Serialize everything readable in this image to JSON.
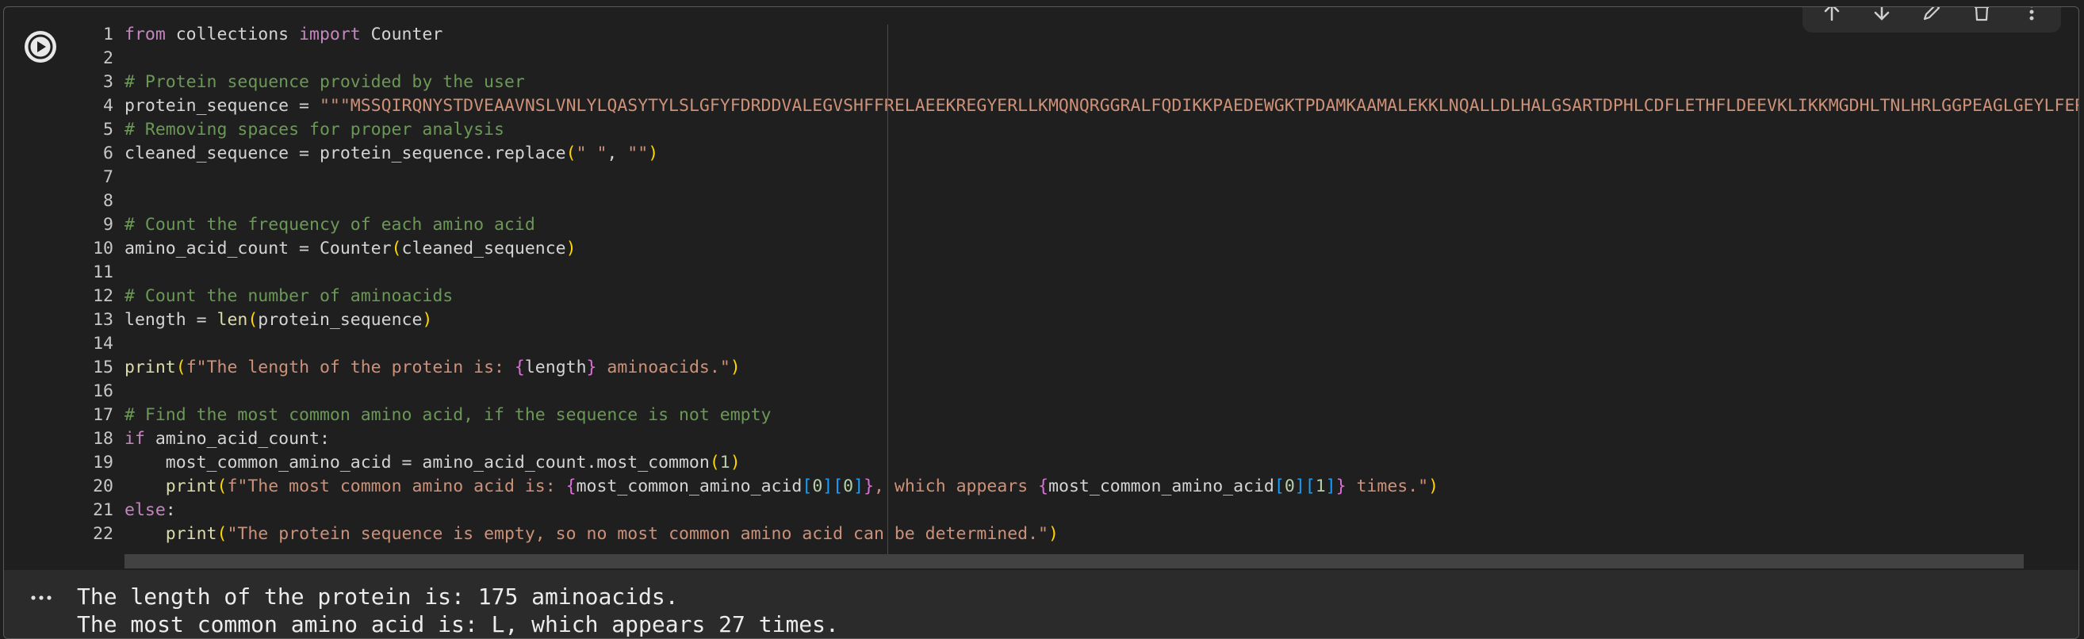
{
  "toolbar": {
    "icons": [
      "move-up-icon",
      "move-down-icon",
      "edit-icon",
      "delete-icon",
      "more-options-icon"
    ]
  },
  "run_button": {
    "icon": "play-icon"
  },
  "code_lines": [
    {
      "n": "1",
      "segments": [
        {
          "t": "from",
          "c": "kw"
        },
        {
          "t": " collections ",
          "c": ""
        },
        {
          "t": "import",
          "c": "kw"
        },
        {
          "t": " Counter",
          "c": ""
        }
      ]
    },
    {
      "n": "2",
      "segments": []
    },
    {
      "n": "3",
      "segments": [
        {
          "t": "# Protein sequence provided by the user",
          "c": "com"
        }
      ]
    },
    {
      "n": "4",
      "segments": [
        {
          "t": "protein_sequence = ",
          "c": ""
        },
        {
          "t": "\"\"\"MSSQIRQNYSTDVEAAVNSLVNLYLQASYTYLSLGFYFDRDDVALEGVSHFFRELAEEKREGYERLLKMQNQRGGRALFQDIKKPAEDEWGKTPDAMKAAMALEKKLNQALLDLHALGSARTDPHLCDFLETHFLDEEVKLIKKMGDHLTNLHRLGGPEAGLGEYLFERLTLKHD\"\"\"",
          "c": "str"
        }
      ]
    },
    {
      "n": "5",
      "segments": [
        {
          "t": "# Removing spaces for proper analysis",
          "c": "com"
        }
      ]
    },
    {
      "n": "6",
      "segments": [
        {
          "t": "cleaned_sequence = protein_sequence.replace",
          "c": ""
        },
        {
          "t": "(",
          "c": "par"
        },
        {
          "t": "\" \"",
          "c": "str"
        },
        {
          "t": ", ",
          "c": ""
        },
        {
          "t": "\"\"",
          "c": "str"
        },
        {
          "t": ")",
          "c": "par"
        }
      ]
    },
    {
      "n": "7",
      "segments": []
    },
    {
      "n": "8",
      "segments": []
    },
    {
      "n": "9",
      "segments": [
        {
          "t": "# Count the frequency of each amino acid",
          "c": "com"
        }
      ]
    },
    {
      "n": "10",
      "segments": [
        {
          "t": "amino_acid_count = Counter",
          "c": ""
        },
        {
          "t": "(",
          "c": "par"
        },
        {
          "t": "cleaned_sequence",
          "c": ""
        },
        {
          "t": ")",
          "c": "par"
        }
      ]
    },
    {
      "n": "11",
      "segments": []
    },
    {
      "n": "12",
      "segments": [
        {
          "t": "# Count the number of aminoacids",
          "c": "com"
        }
      ]
    },
    {
      "n": "13",
      "segments": [
        {
          "t": "length = ",
          "c": ""
        },
        {
          "t": "len",
          "c": "fn"
        },
        {
          "t": "(",
          "c": "par"
        },
        {
          "t": "protein_sequence",
          "c": ""
        },
        {
          "t": ")",
          "c": "par"
        }
      ]
    },
    {
      "n": "14",
      "segments": []
    },
    {
      "n": "15",
      "segments": [
        {
          "t": "print",
          "c": "fn"
        },
        {
          "t": "(",
          "c": "par"
        },
        {
          "t": "f\"The length of the protein is: ",
          "c": "str"
        },
        {
          "t": "{",
          "c": "br2"
        },
        {
          "t": "length",
          "c": ""
        },
        {
          "t": "}",
          "c": "br2"
        },
        {
          "t": " aminoacids.\"",
          "c": "str"
        },
        {
          "t": ")",
          "c": "par"
        }
      ]
    },
    {
      "n": "16",
      "segments": []
    },
    {
      "n": "17",
      "segments": [
        {
          "t": "# Find the most common amino acid, if the sequence is not empty",
          "c": "com"
        }
      ]
    },
    {
      "n": "18",
      "segments": [
        {
          "t": "if",
          "c": "kw"
        },
        {
          "t": " amino_acid_count:",
          "c": ""
        }
      ]
    },
    {
      "n": "19",
      "segments": [
        {
          "t": "    most_common_amino_acid = amino_acid_count.most_common",
          "c": ""
        },
        {
          "t": "(",
          "c": "par"
        },
        {
          "t": "1",
          "c": "num"
        },
        {
          "t": ")",
          "c": "par"
        }
      ]
    },
    {
      "n": "20",
      "segments": [
        {
          "t": "    ",
          "c": ""
        },
        {
          "t": "print",
          "c": "fn"
        },
        {
          "t": "(",
          "c": "par"
        },
        {
          "t": "f\"The most common amino acid is: ",
          "c": "str"
        },
        {
          "t": "{",
          "c": "br2"
        },
        {
          "t": "most_common_amino_acid",
          "c": ""
        },
        {
          "t": "[",
          "c": "br3"
        },
        {
          "t": "0",
          "c": "num"
        },
        {
          "t": "]",
          "c": "br3"
        },
        {
          "t": "[",
          "c": "br3"
        },
        {
          "t": "0",
          "c": "num"
        },
        {
          "t": "]",
          "c": "br3"
        },
        {
          "t": "}",
          "c": "br2"
        },
        {
          "t": ", which appears ",
          "c": "str"
        },
        {
          "t": "{",
          "c": "br2"
        },
        {
          "t": "most_common_amino_acid",
          "c": ""
        },
        {
          "t": "[",
          "c": "br3"
        },
        {
          "t": "0",
          "c": "num"
        },
        {
          "t": "]",
          "c": "br3"
        },
        {
          "t": "[",
          "c": "br3"
        },
        {
          "t": "1",
          "c": "num"
        },
        {
          "t": "]",
          "c": "br3"
        },
        {
          "t": "}",
          "c": "br2"
        },
        {
          "t": " times.\"",
          "c": "str"
        },
        {
          "t": ")",
          "c": "par"
        }
      ]
    },
    {
      "n": "21",
      "segments": [
        {
          "t": "else",
          "c": "kw"
        },
        {
          "t": ":",
          "c": ""
        }
      ]
    },
    {
      "n": "22",
      "segments": [
        {
          "t": "    ",
          "c": ""
        },
        {
          "t": "print",
          "c": "fn"
        },
        {
          "t": "(",
          "c": "par"
        },
        {
          "t": "\"The protein sequence is empty, so no most common amino acid can be determined.\"",
          "c": "str"
        },
        {
          "t": ")",
          "c": "par"
        }
      ]
    }
  ],
  "output": {
    "menu_label": "...",
    "lines": [
      "The length of the protein is: 175 aminoacids.",
      "The most common amino acid is: L, which appears 27 times."
    ]
  }
}
